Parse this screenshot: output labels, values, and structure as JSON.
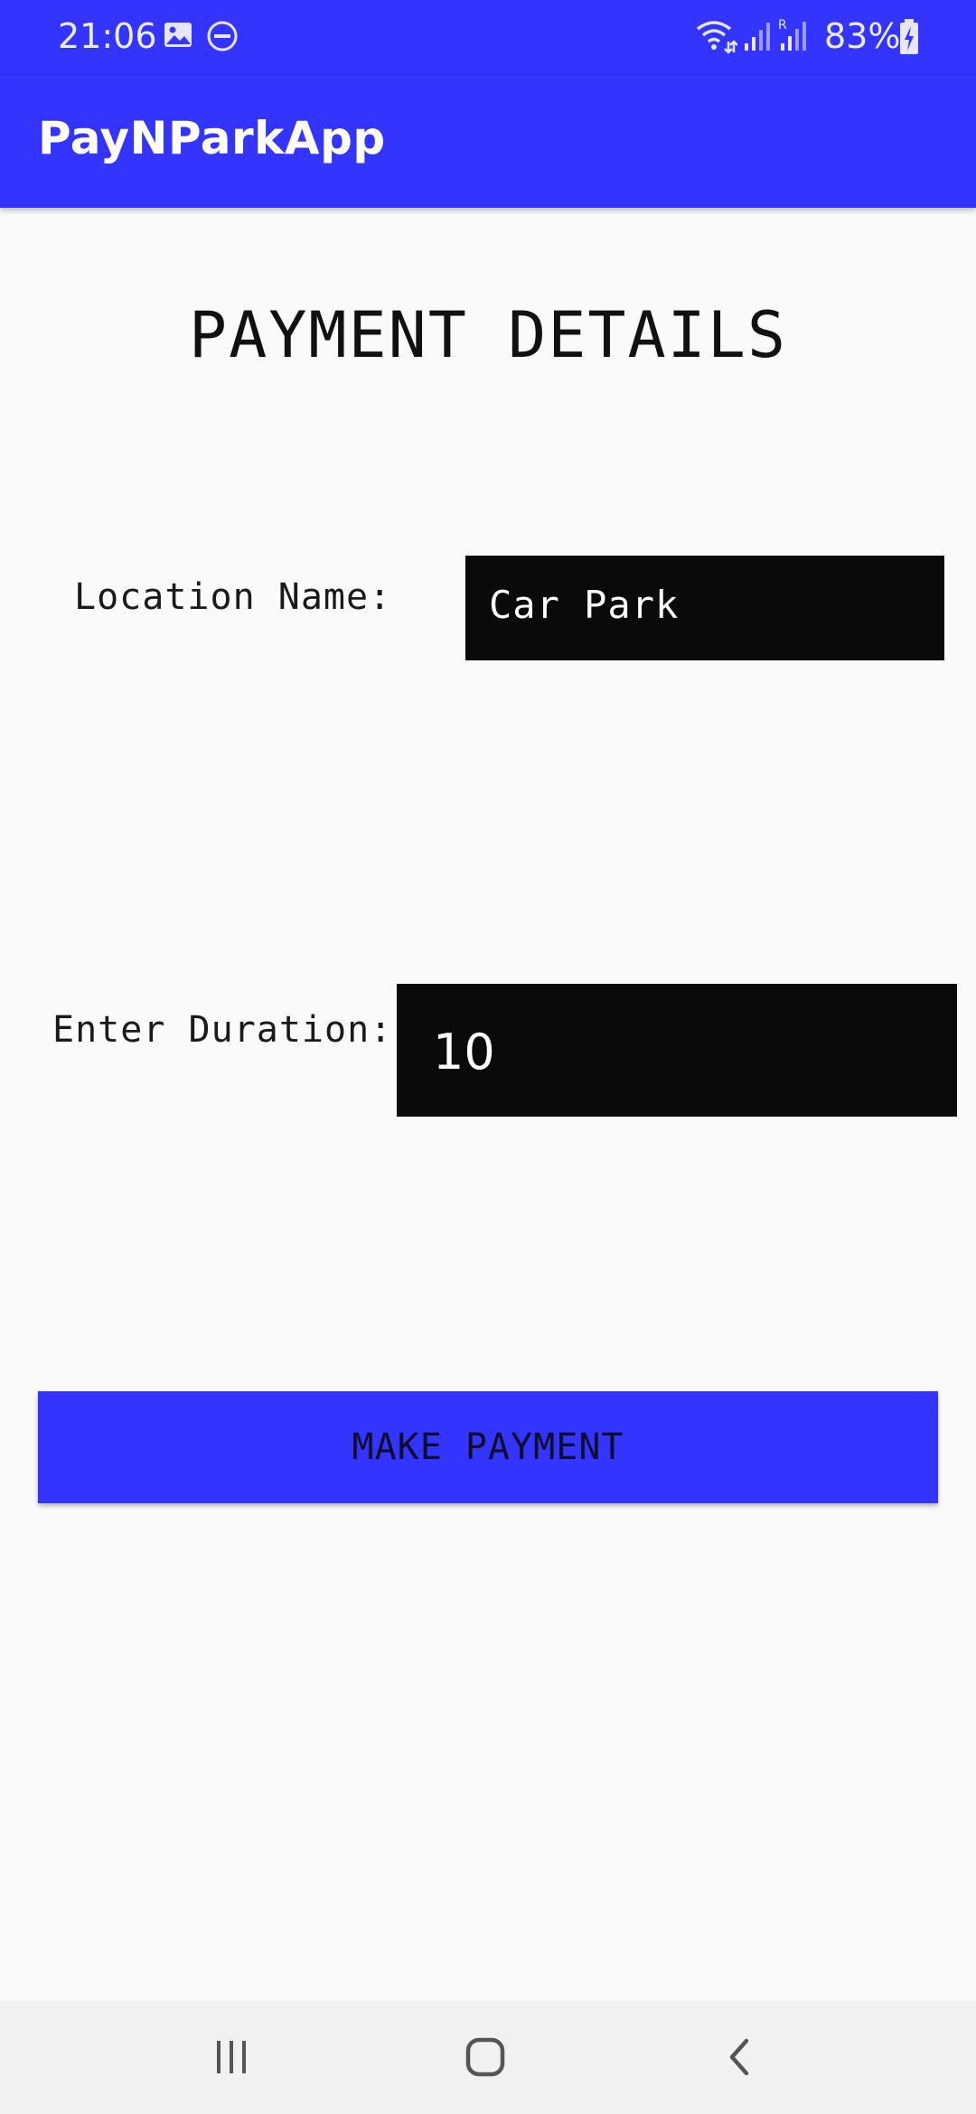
{
  "status_bar": {
    "time": "21:06",
    "battery": "83%",
    "icons": [
      "image-icon",
      "do-not-disturb-icon",
      "wifi-icon",
      "signal-icon",
      "roaming-signal-icon",
      "battery-charging-icon"
    ]
  },
  "app_bar": {
    "title": "PayNParkApp"
  },
  "main": {
    "title": "PAYMENT DETAILS",
    "location": {
      "label": "Location Name:",
      "value": "Car Park"
    },
    "duration": {
      "label": "Enter Duration:",
      "value": "10"
    },
    "submit_label": "MAKE PAYMENT"
  },
  "nav_bar": {
    "buttons": [
      "recent-apps-icon",
      "home-icon",
      "back-icon"
    ]
  },
  "colors": {
    "primary": "#3434ff",
    "field_background": "#0a0a0a",
    "page_background": "#fafafa"
  }
}
